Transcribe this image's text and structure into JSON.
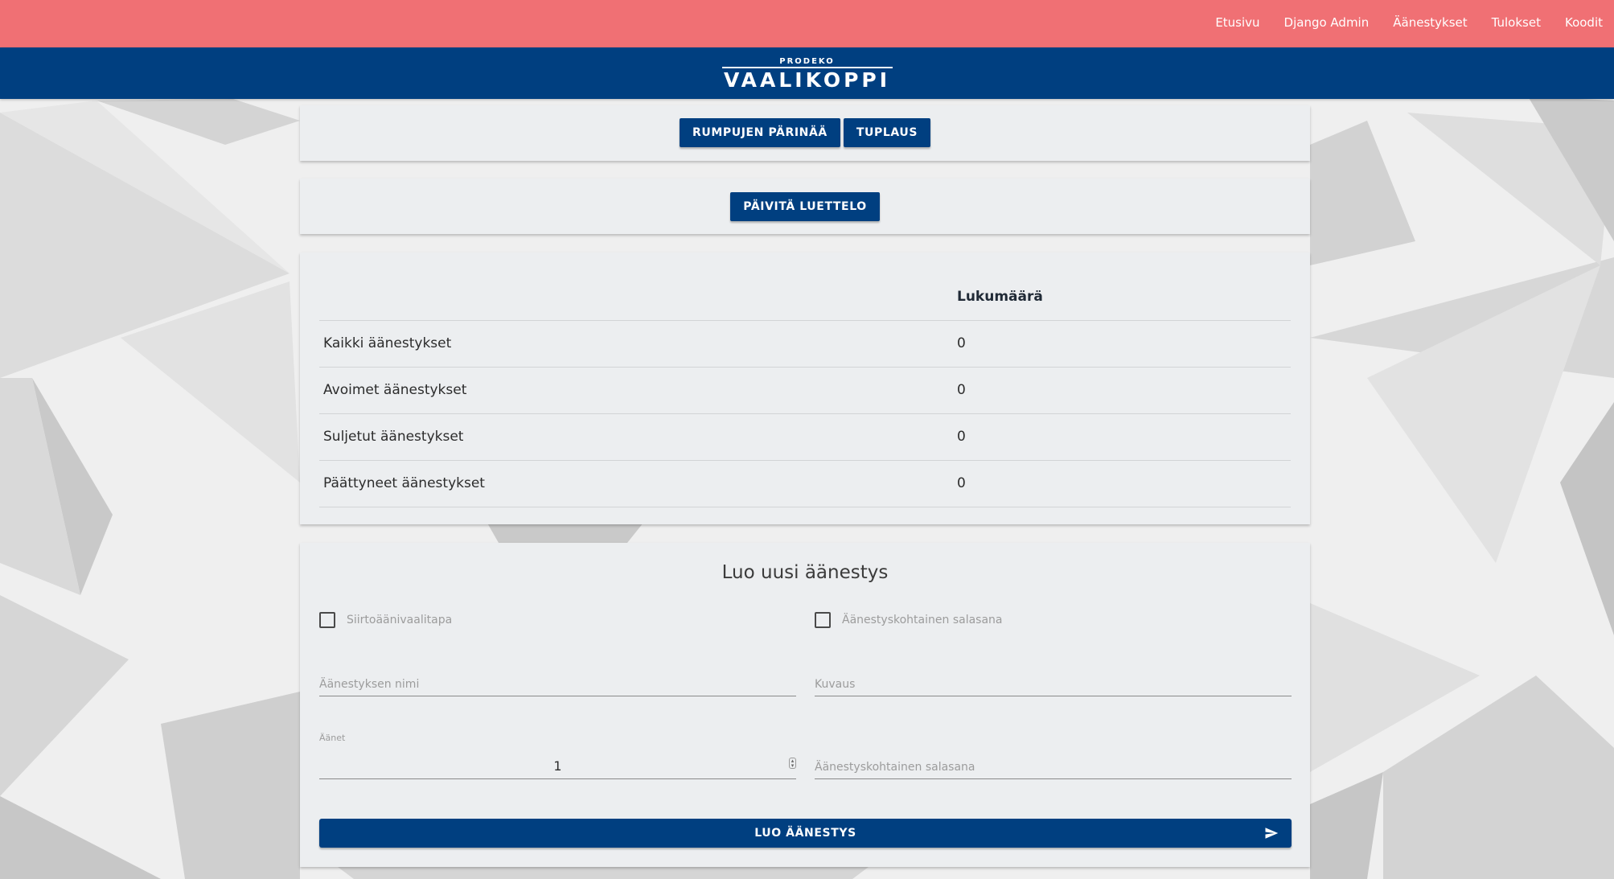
{
  "topnav": {
    "items": [
      "Etusivu",
      "Django Admin",
      "Äänestykset",
      "Tulokset",
      "Koodit"
    ]
  },
  "brand": {
    "small": "PRODEKO",
    "big": "VAALIKOPPI"
  },
  "controls": {
    "drumroll_label": "RUMPUJEN PÄRINÄÄ",
    "double_label": "TUPLAUS",
    "refresh_label": "PÄIVITÄ LUETTELO"
  },
  "stats": {
    "header_count": "Lukumäärä",
    "rows": [
      {
        "label": "Kaikki äänestykset",
        "count": "0"
      },
      {
        "label": "Avoimet äänestykset",
        "count": "0"
      },
      {
        "label": "Suljetut äänestykset",
        "count": "0"
      },
      {
        "label": "Päättyneet äänestykset",
        "count": "0"
      }
    ]
  },
  "form": {
    "title": "Luo uusi äänestys",
    "stv_label": "Siirtoäänivaalitapa",
    "password_toggle_label": "Äänestyskohtainen salasana",
    "name_placeholder": "Äänestyksen nimi",
    "description_placeholder": "Kuvaus",
    "votes_label": "Äänet",
    "votes_value": "1",
    "password_placeholder": "Äänestyskohtainen salasana",
    "submit_label": "LUO ÄÄNESTYS"
  },
  "colors": {
    "topbar": "#f07074",
    "brandbar": "#003f80",
    "primary": "#003f80",
    "card": "#eceef0"
  }
}
